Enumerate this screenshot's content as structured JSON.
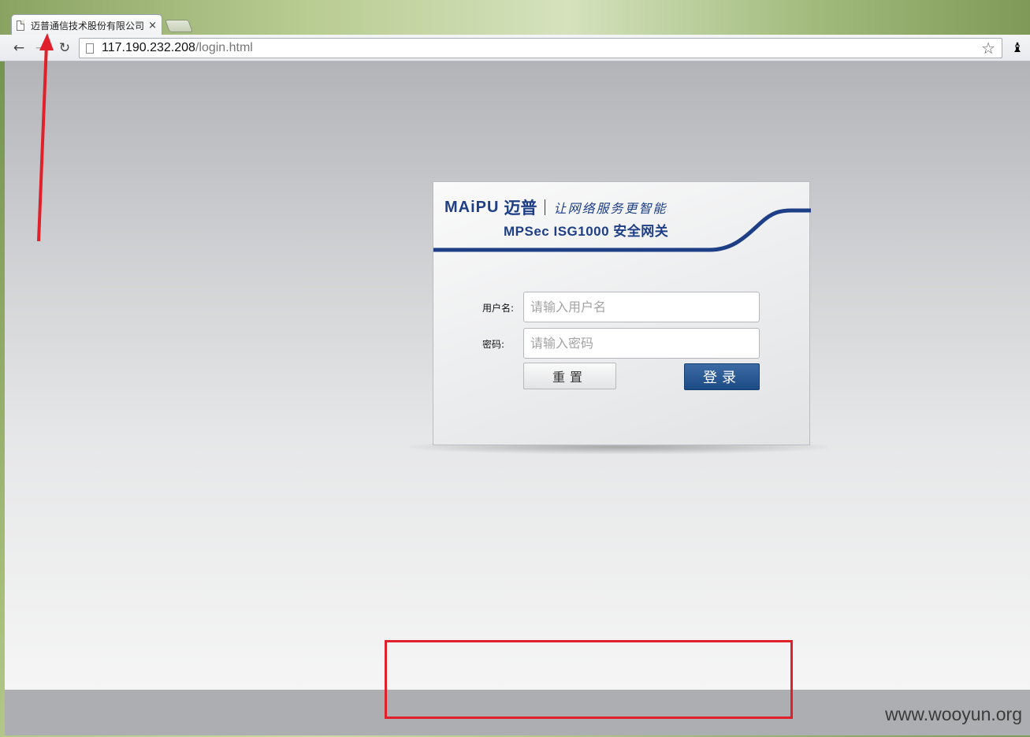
{
  "browser": {
    "tab_title": "迈普通信技术股份有限公司",
    "tab_close": "×",
    "back_icon": "←",
    "forward_icon": "→",
    "reload_icon": "↻",
    "url_host": "117.190.232.208",
    "url_path": "/login.html",
    "star_icon": "☆",
    "extension_icon": "♝"
  },
  "header": {
    "brand_latin": "MAiPU",
    "brand_cn": "迈普",
    "slogan": "让网络服务更智能",
    "product": "MPSec  ISG1000  安全网关",
    "accent_color": "#1e3f86"
  },
  "form": {
    "username_label": "用户名:",
    "username_placeholder": "请输入用户名",
    "password_label": "密码:",
    "password_placeholder": "请输入密码",
    "reset_label": "重置",
    "login_label": "登录"
  },
  "watermark": "www.wooyun.org",
  "annotation_color": "#e0202a"
}
